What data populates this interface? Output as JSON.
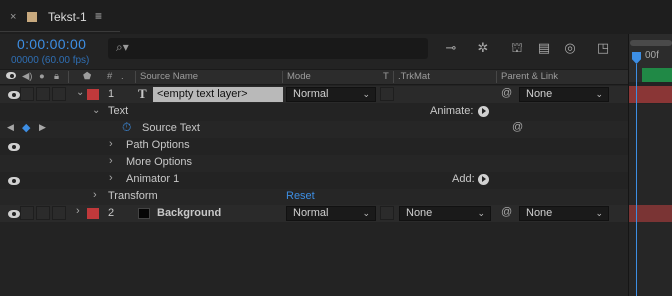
{
  "tab": {
    "close": "×",
    "title": "Tekst-1",
    "menu": "≡"
  },
  "time": {
    "timecode": "0:00:00:00",
    "frames": "00000 (60.00 fps)"
  },
  "search": {
    "glyph": "⌕▾",
    "placeholder": ""
  },
  "ruler": {
    "label": "00f"
  },
  "columns": {
    "source_name": "Source Name",
    "mode": "Mode",
    "t": "T",
    "trkmat": ".TrkMat",
    "parent": "Parent & Link",
    "hash": "#",
    "dot": "."
  },
  "layer1": {
    "number": "1",
    "type_glyph": "T",
    "name": "<empty text layer>",
    "mode": "Normal",
    "parent": "None",
    "pickwhip": "@"
  },
  "text_group": {
    "label": "Text",
    "animate_label": "Animate:",
    "source_text": "Source Text",
    "path_options": "Path Options",
    "more_options": "More Options",
    "animator": "Animator 1",
    "add_label": "Add:",
    "transform": "Transform",
    "reset": "Reset"
  },
  "layer2": {
    "number": "2",
    "name": "Background",
    "mode": "Normal",
    "trkmat": "None",
    "parent": "None",
    "pickwhip": "@"
  },
  "colors": {
    "accent": "#3d8ee3",
    "label_red": "#c0393b",
    "track_red": "#8a3636",
    "work_area_green": "#1f9a4b"
  }
}
